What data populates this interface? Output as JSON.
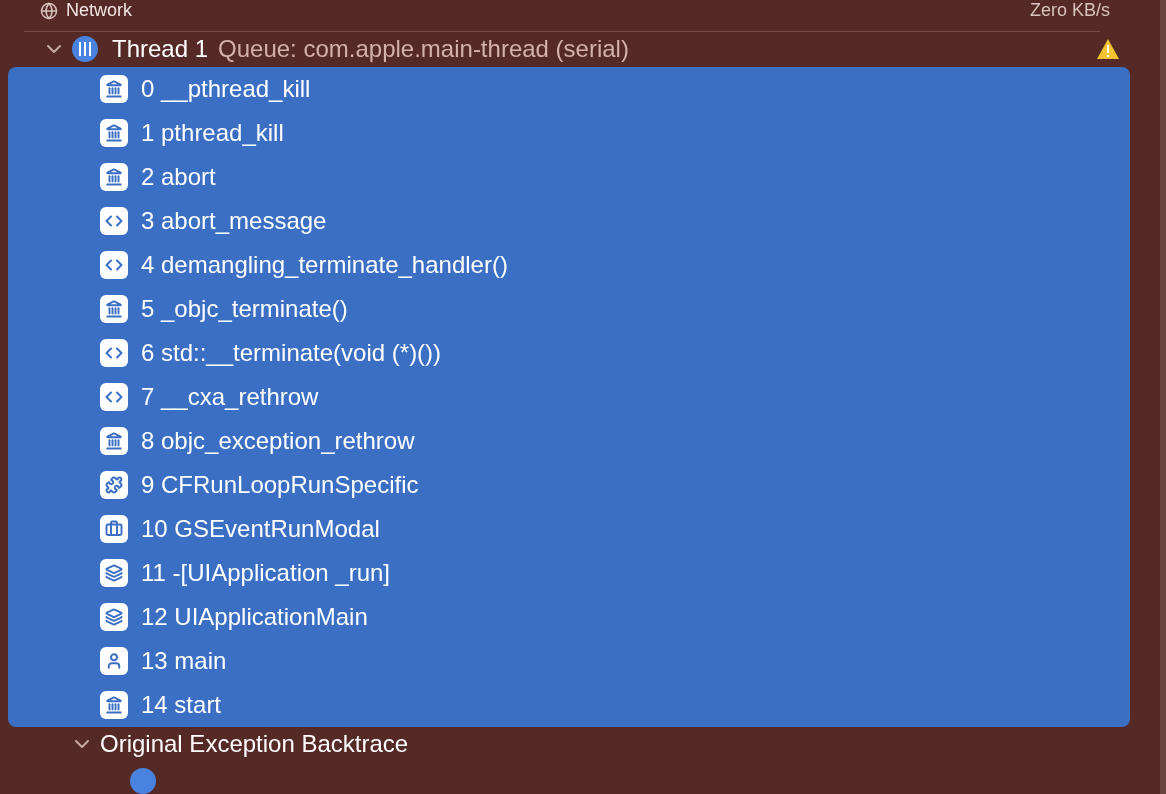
{
  "section_header": {
    "title": "Network",
    "value": "Zero KB/s"
  },
  "thread": {
    "name": "Thread 1",
    "queue": "Queue: com.apple.main-thread (serial)",
    "expanded": true,
    "warning": true
  },
  "frames": [
    {
      "kind": "library",
      "label": "0 __pthread_kill",
      "selected": true
    },
    {
      "kind": "library",
      "label": "1 pthread_kill",
      "selected": true
    },
    {
      "kind": "library",
      "label": "2 abort",
      "selected": true
    },
    {
      "kind": "code",
      "label": "3 abort_message",
      "selected": true
    },
    {
      "kind": "code",
      "label": "4 demangling_terminate_handler()",
      "selected": true
    },
    {
      "kind": "library",
      "label": "5 _objc_terminate()",
      "selected": true
    },
    {
      "kind": "code",
      "label": "6 std::__terminate(void (*)())",
      "selected": true
    },
    {
      "kind": "code",
      "label": "7 __cxa_rethrow",
      "selected": true
    },
    {
      "kind": "library",
      "label": "8 objc_exception_rethrow",
      "selected": true
    },
    {
      "kind": "plugin",
      "label": "9 CFRunLoopRunSpecific",
      "selected": true
    },
    {
      "kind": "toolbox",
      "label": "10 GSEventRunModal",
      "selected": true
    },
    {
      "kind": "stack",
      "label": "11 -[UIApplication _run]",
      "selected": true
    },
    {
      "kind": "stack",
      "label": "12 UIApplicationMain",
      "selected": true
    },
    {
      "kind": "user",
      "label": "13 main",
      "selected": true
    },
    {
      "kind": "library",
      "label": "14 start",
      "selected": true
    }
  ],
  "backtrace": {
    "title": "Original Exception Backtrace",
    "expanded": true
  }
}
